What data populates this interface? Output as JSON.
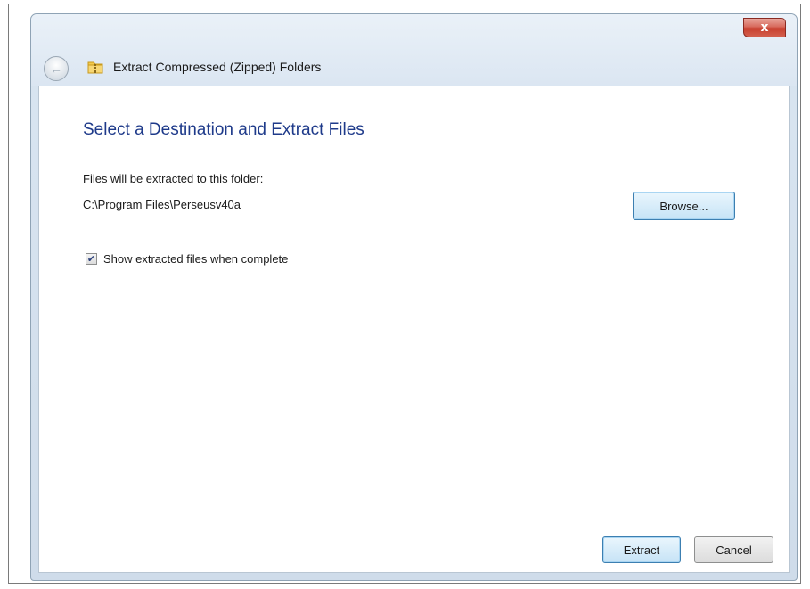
{
  "window": {
    "title": "Extract Compressed (Zipped) Folders",
    "close_glyph": "x",
    "back_icon": "back-arrow-icon",
    "title_icon": "zipped-folder-icon"
  },
  "main": {
    "heading": "Select a Destination and Extract Files",
    "folder_label": "Files will be extracted to this folder:",
    "folder_path": "C:\\Program Files\\Perseusv40a",
    "browse_label": "Browse...",
    "show_files_label": "Show extracted files when complete",
    "show_files_checked": true
  },
  "footer": {
    "extract_label": "Extract",
    "cancel_label": "Cancel"
  },
  "colors": {
    "heading": "#1e3a8a",
    "close_button": "#c8402f",
    "focused_button_border": "#3c7fb1"
  }
}
